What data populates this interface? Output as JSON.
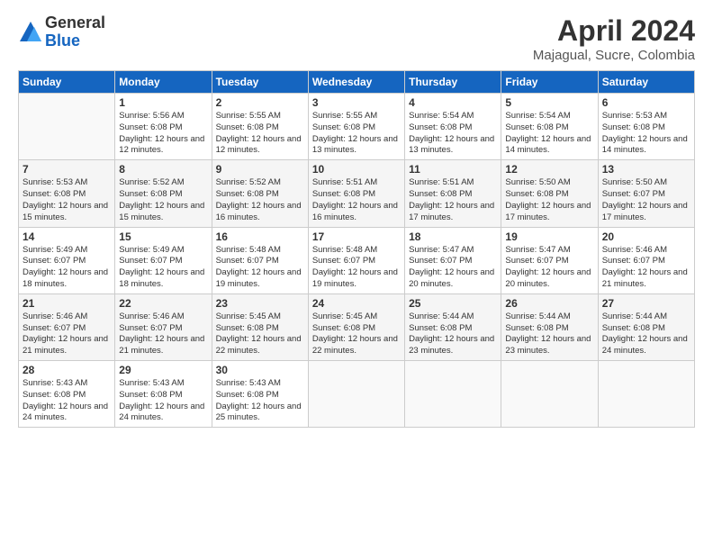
{
  "logo": {
    "general": "General",
    "blue": "Blue"
  },
  "header": {
    "title": "April 2024",
    "location": "Majagual, Sucre, Colombia"
  },
  "weekdays": [
    "Sunday",
    "Monday",
    "Tuesday",
    "Wednesday",
    "Thursday",
    "Friday",
    "Saturday"
  ],
  "weeks": [
    [
      {
        "day": "",
        "info": ""
      },
      {
        "day": "1",
        "info": "Sunrise: 5:56 AM\nSunset: 6:08 PM\nDaylight: 12 hours\nand 12 minutes."
      },
      {
        "day": "2",
        "info": "Sunrise: 5:55 AM\nSunset: 6:08 PM\nDaylight: 12 hours\nand 12 minutes."
      },
      {
        "day": "3",
        "info": "Sunrise: 5:55 AM\nSunset: 6:08 PM\nDaylight: 12 hours\nand 13 minutes."
      },
      {
        "day": "4",
        "info": "Sunrise: 5:54 AM\nSunset: 6:08 PM\nDaylight: 12 hours\nand 13 minutes."
      },
      {
        "day": "5",
        "info": "Sunrise: 5:54 AM\nSunset: 6:08 PM\nDaylight: 12 hours\nand 14 minutes."
      },
      {
        "day": "6",
        "info": "Sunrise: 5:53 AM\nSunset: 6:08 PM\nDaylight: 12 hours\nand 14 minutes."
      }
    ],
    [
      {
        "day": "7",
        "info": "Sunrise: 5:53 AM\nSunset: 6:08 PM\nDaylight: 12 hours\nand 15 minutes."
      },
      {
        "day": "8",
        "info": "Sunrise: 5:52 AM\nSunset: 6:08 PM\nDaylight: 12 hours\nand 15 minutes."
      },
      {
        "day": "9",
        "info": "Sunrise: 5:52 AM\nSunset: 6:08 PM\nDaylight: 12 hours\nand 16 minutes."
      },
      {
        "day": "10",
        "info": "Sunrise: 5:51 AM\nSunset: 6:08 PM\nDaylight: 12 hours\nand 16 minutes."
      },
      {
        "day": "11",
        "info": "Sunrise: 5:51 AM\nSunset: 6:08 PM\nDaylight: 12 hours\nand 17 minutes."
      },
      {
        "day": "12",
        "info": "Sunrise: 5:50 AM\nSunset: 6:08 PM\nDaylight: 12 hours\nand 17 minutes."
      },
      {
        "day": "13",
        "info": "Sunrise: 5:50 AM\nSunset: 6:07 PM\nDaylight: 12 hours\nand 17 minutes."
      }
    ],
    [
      {
        "day": "14",
        "info": "Sunrise: 5:49 AM\nSunset: 6:07 PM\nDaylight: 12 hours\nand 18 minutes."
      },
      {
        "day": "15",
        "info": "Sunrise: 5:49 AM\nSunset: 6:07 PM\nDaylight: 12 hours\nand 18 minutes."
      },
      {
        "day": "16",
        "info": "Sunrise: 5:48 AM\nSunset: 6:07 PM\nDaylight: 12 hours\nand 19 minutes."
      },
      {
        "day": "17",
        "info": "Sunrise: 5:48 AM\nSunset: 6:07 PM\nDaylight: 12 hours\nand 19 minutes."
      },
      {
        "day": "18",
        "info": "Sunrise: 5:47 AM\nSunset: 6:07 PM\nDaylight: 12 hours\nand 20 minutes."
      },
      {
        "day": "19",
        "info": "Sunrise: 5:47 AM\nSunset: 6:07 PM\nDaylight: 12 hours\nand 20 minutes."
      },
      {
        "day": "20",
        "info": "Sunrise: 5:46 AM\nSunset: 6:07 PM\nDaylight: 12 hours\nand 21 minutes."
      }
    ],
    [
      {
        "day": "21",
        "info": "Sunrise: 5:46 AM\nSunset: 6:07 PM\nDaylight: 12 hours\nand 21 minutes."
      },
      {
        "day": "22",
        "info": "Sunrise: 5:46 AM\nSunset: 6:07 PM\nDaylight: 12 hours\nand 21 minutes."
      },
      {
        "day": "23",
        "info": "Sunrise: 5:45 AM\nSunset: 6:08 PM\nDaylight: 12 hours\nand 22 minutes."
      },
      {
        "day": "24",
        "info": "Sunrise: 5:45 AM\nSunset: 6:08 PM\nDaylight: 12 hours\nand 22 minutes."
      },
      {
        "day": "25",
        "info": "Sunrise: 5:44 AM\nSunset: 6:08 PM\nDaylight: 12 hours\nand 23 minutes."
      },
      {
        "day": "26",
        "info": "Sunrise: 5:44 AM\nSunset: 6:08 PM\nDaylight: 12 hours\nand 23 minutes."
      },
      {
        "day": "27",
        "info": "Sunrise: 5:44 AM\nSunset: 6:08 PM\nDaylight: 12 hours\nand 24 minutes."
      }
    ],
    [
      {
        "day": "28",
        "info": "Sunrise: 5:43 AM\nSunset: 6:08 PM\nDaylight: 12 hours\nand 24 minutes."
      },
      {
        "day": "29",
        "info": "Sunrise: 5:43 AM\nSunset: 6:08 PM\nDaylight: 12 hours\nand 24 minutes."
      },
      {
        "day": "30",
        "info": "Sunrise: 5:43 AM\nSunset: 6:08 PM\nDaylight: 12 hours\nand 25 minutes."
      },
      {
        "day": "",
        "info": ""
      },
      {
        "day": "",
        "info": ""
      },
      {
        "day": "",
        "info": ""
      },
      {
        "day": "",
        "info": ""
      }
    ]
  ]
}
